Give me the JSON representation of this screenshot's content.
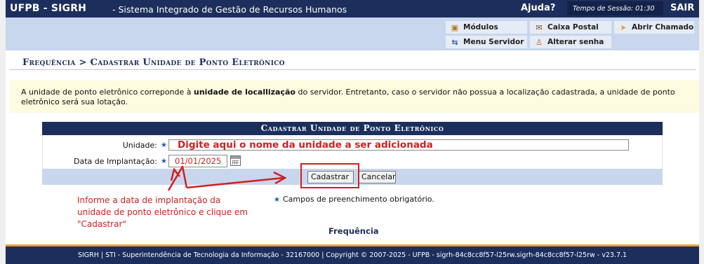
{
  "topbar": {
    "brand": "UFPB - SIGRH",
    "system": "- Sistema Integrado de Gestão de Recursos Humanos",
    "help": "Ajuda?",
    "session": "Tempo de Sessão: 01:30",
    "exit": "SAIR"
  },
  "menu": {
    "modulos": "Módulos",
    "caixa_postal": "Caixa Postal",
    "abrir_chamado": "Abrir Chamado",
    "menu_servidor": "Menu Servidor",
    "alterar_senha": "Alterar senha"
  },
  "breadcrumb": "Frequência > Cadastrar Unidade de Ponto Eletrônico",
  "notice": {
    "part1": "A unidade de ponto eletrônico correponde à ",
    "bold": "unidade de locallização",
    "part2": " do servidor. Entretanto, caso o servidor não possua a localização cadastrada, a unidade de ponto eletrônico será sua lotação."
  },
  "form": {
    "title": "Cadastrar Unidade de Ponto Eletrônico",
    "unidade_label": "Unidade:",
    "unidade_value": "Digite aqui o nome da unidade a ser adicionada",
    "data_label": "Data de Implantação:",
    "data_value": "01/01/2025",
    "submit": "Cadastrar",
    "cancel": "Cancelar",
    "required_star": "★"
  },
  "annotation": "Informe a data de implantação da unidade de ponto eletrônico e clique em \"Cadastrar\"",
  "required_note": "Campos de preenchimento obrigatório.",
  "back_link": "Frequência",
  "footer": "SIGRH | STI - Superintendência de Tecnologia da Informação - 32167000 | Copyright © 2007-2025 - UFPB - sigrh-84c8cc8f57-l25rw.sigrh-84c8cc8f57-l25rw - v23.7.1",
  "colors": {
    "header": "#1c2e5c",
    "menu_bg": "#c8d6ee",
    "annotation": "#d21f1f",
    "footer_accent": "#e8a13a"
  },
  "icons": [
    "cube-icon",
    "mailbox-icon",
    "ticket-icon",
    "network-icon",
    "person-key-icon",
    "star-icon",
    "calendar-icon"
  ]
}
